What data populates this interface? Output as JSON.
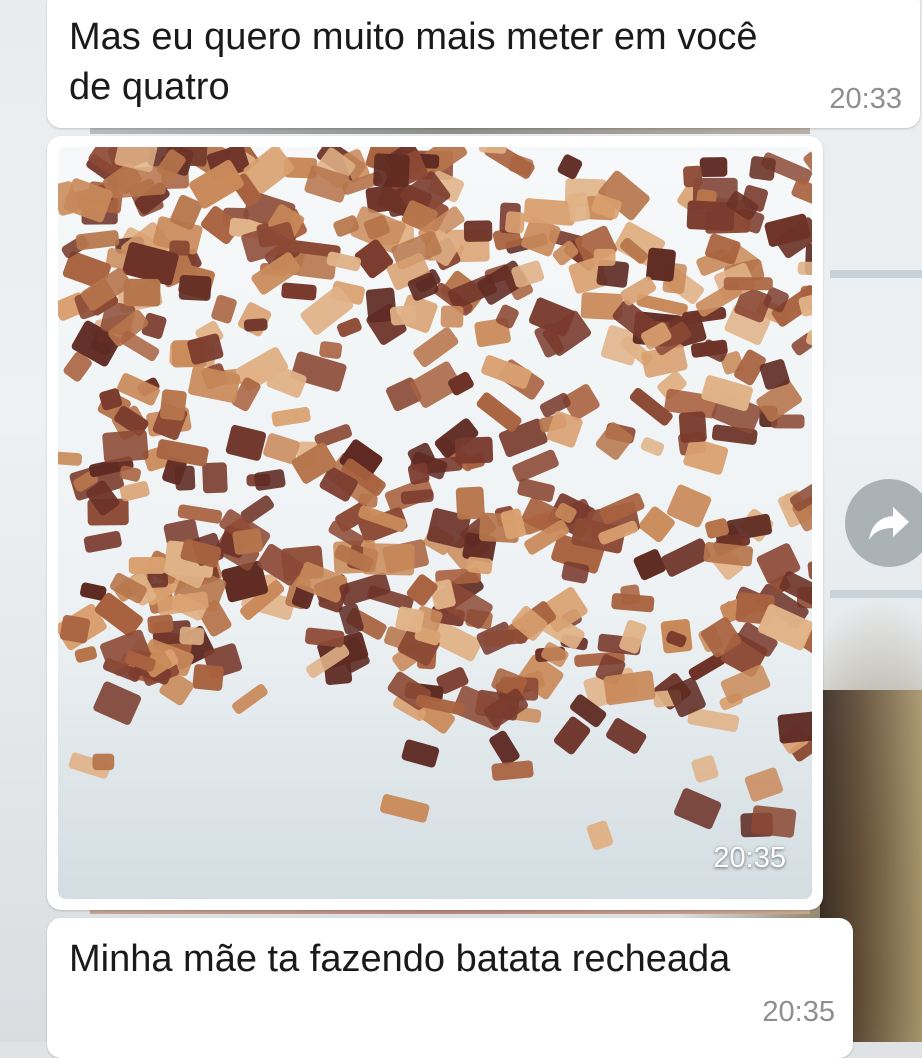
{
  "messages": [
    {
      "text_line1": "Mas eu quero muito mais meter em você",
      "text_line2": "de quatro",
      "time": "20:33"
    },
    {
      "type": "image",
      "time": "20:35"
    },
    {
      "text": "Minha mãe ta fazendo batata recheada",
      "time": "20:35"
    }
  ],
  "icons": {
    "forward": "forward-icon"
  },
  "colors": {
    "bubble": "#ffffff",
    "text": "#1a1a1a",
    "timestamp": "#8f8f8f"
  }
}
